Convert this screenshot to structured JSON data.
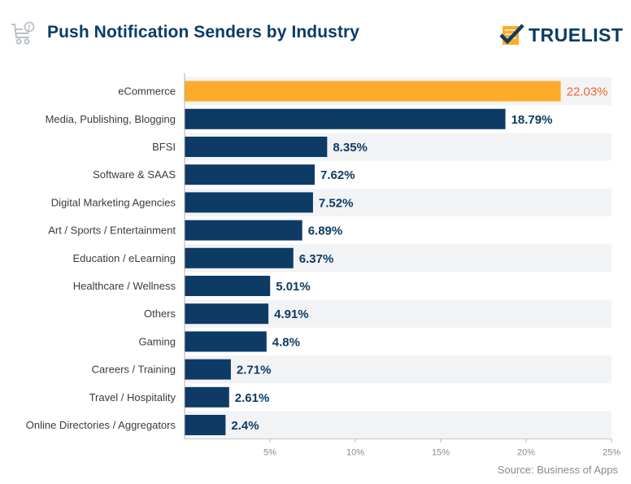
{
  "header": {
    "title": "Push Notification Senders by Industry",
    "brand": "TRUELIST",
    "icon": "shopping-cart-notification-icon",
    "brand_icon": "checklist-check-icon"
  },
  "source": "Source: Business of Apps",
  "colors": {
    "bar": "#0d3b66",
    "highlight_bar": "#fdab2a",
    "highlight_label": "#f2642b",
    "band": "#f2f3f5"
  },
  "chart_data": {
    "type": "bar",
    "orientation": "horizontal",
    "title": "Push Notification Senders by Industry",
    "xlabel": "",
    "ylabel": "",
    "xlim": [
      0,
      25
    ],
    "xticks": [
      5,
      10,
      15,
      20,
      25
    ],
    "xtick_labels": [
      "5%",
      "10%",
      "15%",
      "20%",
      "25%"
    ],
    "grid": false,
    "legend": "none",
    "highlight_index": 0,
    "categories": [
      "eCommerce",
      "Media, Publishing, Blogging",
      "BFSI",
      "Software & SAAS",
      "Digital Marketing Agencies",
      "Art / Sports / Entertainment",
      "Education / eLearning",
      "Healthcare / Wellness",
      "Others",
      "Gaming",
      "Careers / Training",
      "Travel / Hospitality",
      "Online Directories / Aggregators"
    ],
    "values": [
      22.03,
      18.79,
      8.35,
      7.62,
      7.52,
      6.89,
      6.37,
      5.01,
      4.91,
      4.8,
      2.71,
      2.61,
      2.4
    ],
    "value_labels": [
      "22.03%",
      "18.79%",
      "8.35%",
      "7.62%",
      "7.52%",
      "6.89%",
      "6.37%",
      "5.01%",
      "4.91%",
      "4.8%",
      "2.71%",
      "2.61%",
      "2.4%"
    ]
  }
}
